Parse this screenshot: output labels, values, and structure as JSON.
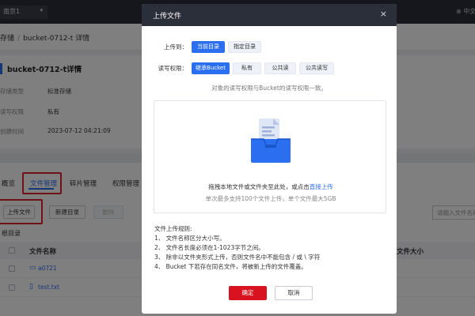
{
  "topbar": {
    "region": "南京1",
    "lang": "中文"
  },
  "breadcrumb": {
    "root": "存储",
    "current": "bucket-0712-t 详情"
  },
  "bucket": {
    "title": "bucket-0712-t详情",
    "fields": [
      {
        "label": "存储类型",
        "value": "标准存储"
      },
      {
        "label": "读写权限",
        "value": "私有"
      },
      {
        "label": "创建时间",
        "value": "2023-07-12 04:21:09"
      }
    ]
  },
  "tabs": [
    "概览",
    "文件管理",
    "碎片管理",
    "权限管理"
  ],
  "file_toolbar": {
    "upload": "上传文件",
    "new_folder": "新建目录",
    "delete": "删除",
    "search_placeholder": "请输入文件名称"
  },
  "root_label": "根目录",
  "table": {
    "columns": [
      "文件名称",
      "文件大小"
    ],
    "rows": [
      {
        "icon": "folder-icon",
        "name": "a0721"
      },
      {
        "icon": "file-icon",
        "name": "test.txt"
      }
    ]
  },
  "modal": {
    "title": "上传文件",
    "upload_to_label": "上传到：",
    "upload_to_options": [
      "当前目录",
      "指定目录"
    ],
    "permission_label": "读写权限：",
    "permission_options": [
      "继承Bucket",
      "私有",
      "公共读",
      "公共读写"
    ],
    "permission_hint": "对象的读写权限与Bucket的读写权限一致。",
    "drop_text": "拖拽本地文件或文件夹至此处，或点击",
    "drop_link": "直接上传",
    "drop_limit": "单次最多支持100个文件上传，单个文件最大5GB",
    "rules_title": "文件上传规则:",
    "rules": [
      "1、 文件名称区分大小写。",
      "2、 文件名长度必须在1-1023字节之间。",
      "3、 除非以文件夹形式上传，否则文件名中不能包含 / 或 \\ 字符",
      "4、 Bucket 下若存在同名文件，将被新上传的文件覆盖。"
    ],
    "confirm": "确定",
    "cancel": "取消"
  },
  "colors": {
    "primary": "#2b6ff0",
    "danger": "#d8131f",
    "header": "#2b2f3a",
    "highlight": "#e0202e"
  }
}
